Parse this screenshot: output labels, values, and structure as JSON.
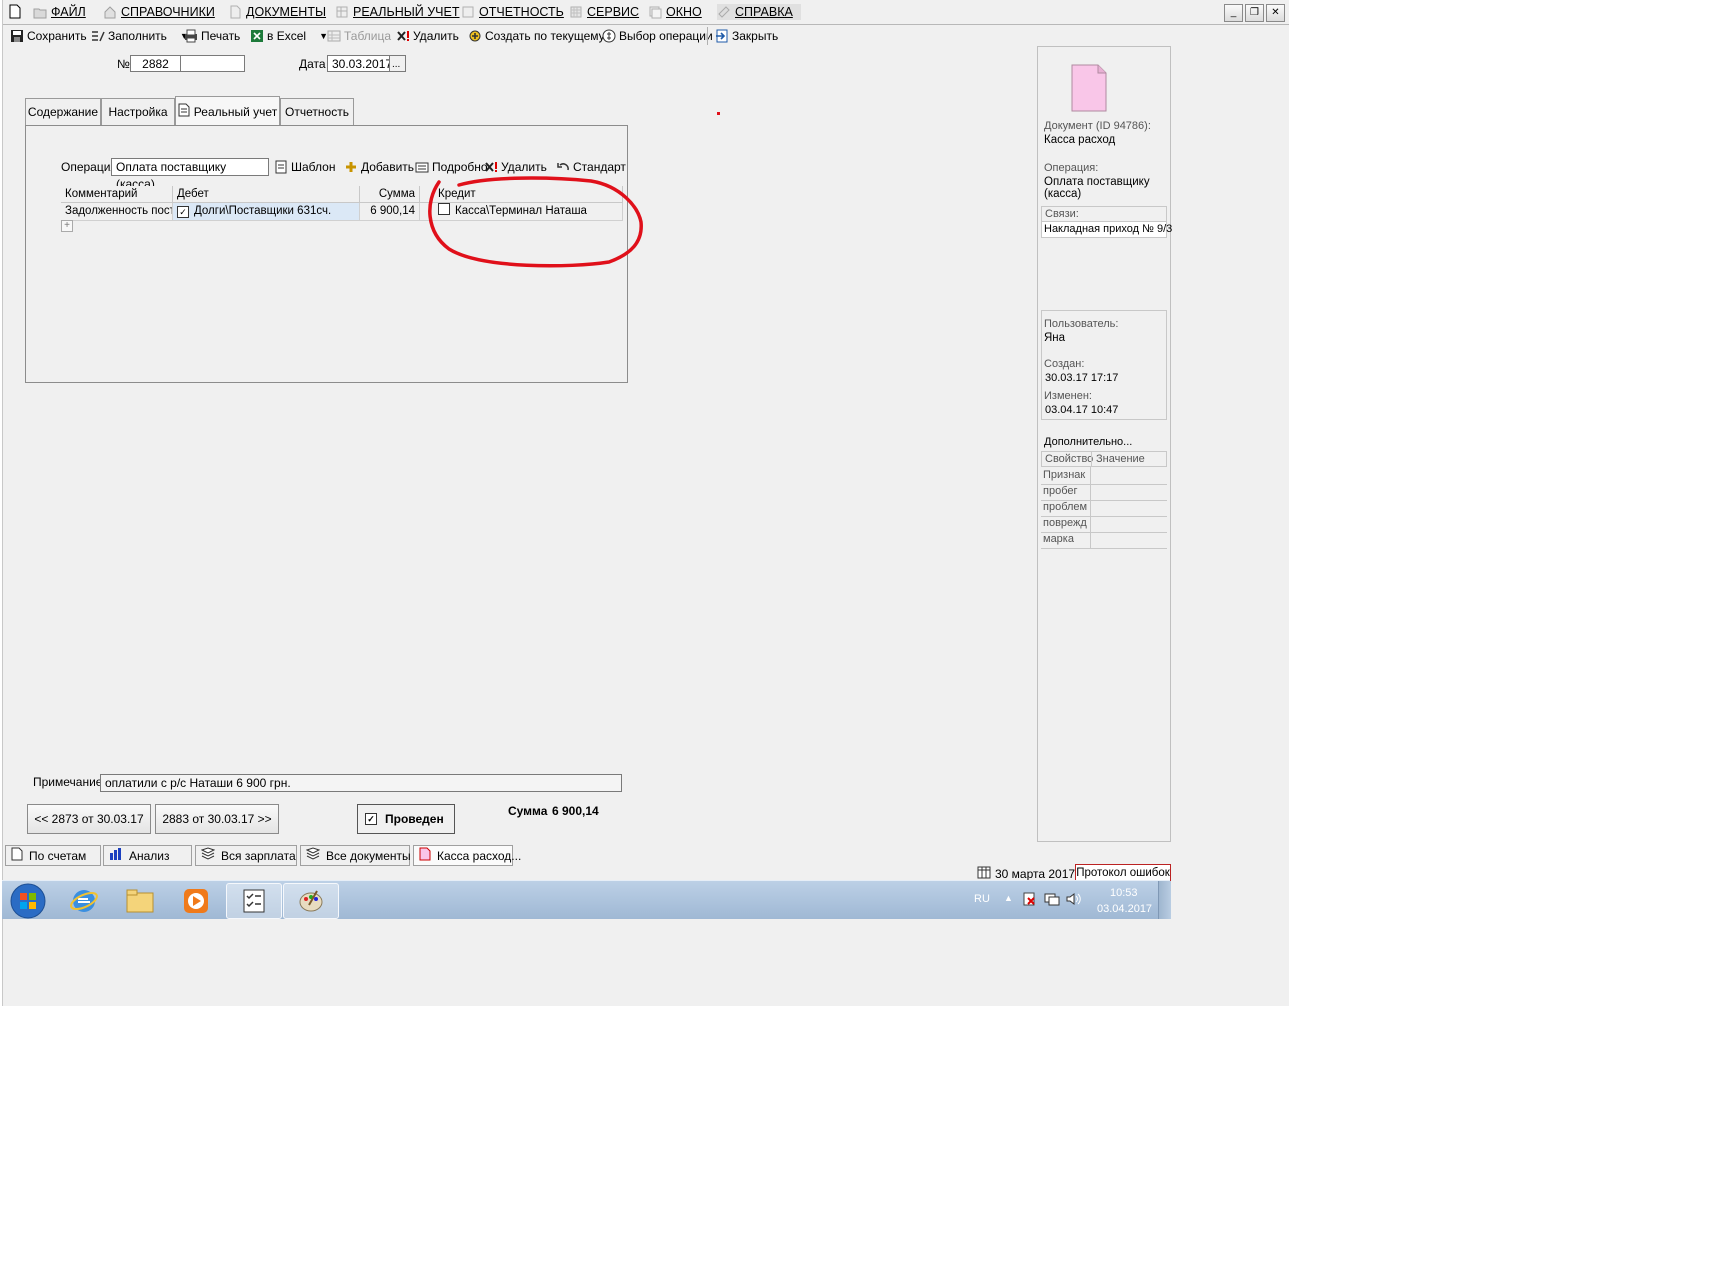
{
  "menu": {
    "items": [
      "ФАЙЛ",
      "СПРАВОЧНИКИ",
      "ДОКУМЕНТЫ",
      "РЕАЛЬНЫЙ УЧЕТ",
      "ОТЧЕТНОСТЬ",
      "СЕРВИС",
      "ОКНО",
      "СПРАВКА"
    ],
    "win_minimize": "_",
    "win_restore": "❐",
    "win_close": "✕"
  },
  "toolbar": {
    "save": "Сохранить",
    "fill": "Заполнить",
    "print": "Печать",
    "excel": "в Excel",
    "table": "Таблица",
    "delete": "Удалить",
    "create_from_current": "Создать по текущему",
    "choose_operation": "Выбор операции",
    "close": "Закрыть"
  },
  "header": {
    "number_label": "№",
    "number_value": "2882",
    "number_suffix": "",
    "date_label": "Дата",
    "date_value": "30.03.2017",
    "date_button": "..."
  },
  "tabs": [
    "Содержание",
    "Настройка",
    "Реальный учет",
    "Отчетность"
  ],
  "operation": {
    "label": "Операция",
    "value": "Оплата поставщику (касса)",
    "template": "Шаблон",
    "add": "Добавить",
    "details": "Подробно",
    "delete": "Удалить",
    "standard": "Стандарт"
  },
  "grid": {
    "columns": [
      "Комментарий",
      "Дебет",
      "Сумма",
      "Кредит"
    ],
    "rows": [
      {
        "comment": "Задолженность поста",
        "debit": "Долги\\Поставщики 631сч.",
        "debit_checked": true,
        "amount": "6 900,14",
        "credit": "Касса\\Терминал Наташа",
        "credit_checked": false
      }
    ],
    "add_row": "+"
  },
  "note": {
    "label": "Примечание",
    "value": "оплатили с р/с Наташи 6 900 грн."
  },
  "nav": {
    "prev": "<< 2873 от 30.03.17",
    "next": "2883 от 30.03.17 >>",
    "posted_label": "Проведен",
    "posted_checked": true,
    "sum_label": "Сумма",
    "sum_value": "6 900,14"
  },
  "sidebar": {
    "doc_label": "Документ  (ID 94786):",
    "doc_value": "Касса расход",
    "op_label": "Операция:",
    "op_value_1": "Оплата поставщику",
    "op_value_2": "(касса)",
    "links_label": "Связи:",
    "links_value": "Накладная приход № 9/3",
    "user_label": "Пользователь:",
    "user_value": "Яна",
    "created_label": "Создан:",
    "created_value": "30.03.17  17:17",
    "modified_label": "Изменен:",
    "modified_value": "03.04.17  10:47",
    "more": "Дополнительно...",
    "props_header": [
      "Свойство",
      "Значение"
    ],
    "props": [
      "Признак",
      "пробег",
      "проблем",
      "поврежд",
      "марка"
    ]
  },
  "window_tabs": [
    "По счетам",
    "Анализ",
    "Вся зарплата",
    "Все документы",
    "Касса расход..."
  ],
  "status": {
    "date": "30 марта 2017г",
    "errors": "Протокол ошибок"
  },
  "taskbar": {
    "lang": "RU",
    "time": "10:53",
    "date": "03.04.2017"
  },
  "colors": {
    "annotation_circle": "#e0101a",
    "doc_icon_fill": "#f9c6e8",
    "selected_row": "#dbe8f6"
  }
}
